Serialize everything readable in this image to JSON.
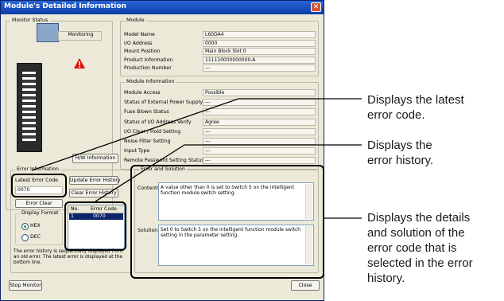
{
  "window": {
    "title": "Module's Detailed Information",
    "close_glyph": "✕"
  },
  "monitor_status": {
    "group_label": "Monitor Status",
    "state": "Monitoring"
  },
  "module": {
    "group_label": "Module",
    "rows": [
      {
        "label": "Model Name",
        "value": "L60DA4"
      },
      {
        "label": "I/O Address",
        "value": "0000"
      },
      {
        "label": "Mount Position",
        "value": "Main Block Slot 0"
      },
      {
        "label": "Product Information",
        "value": "111110000000000-A"
      },
      {
        "label": "Production Number",
        "value": "---"
      }
    ]
  },
  "module_information": {
    "group_label": "Module Information",
    "rows": [
      {
        "label": "Module Access",
        "value": "Possible"
      },
      {
        "label": "Status of External Power Supply",
        "value": "---"
      },
      {
        "label": "Fuse Blown Status",
        "value": "---"
      },
      {
        "label": "Status of I/O Address Verify",
        "value": "Agree"
      },
      {
        "label": "I/O Clear / Hold Setting",
        "value": "---"
      },
      {
        "label": "Noise Filter Setting",
        "value": "---"
      },
      {
        "label": "Input Type",
        "value": "---"
      },
      {
        "label": "Remote Password Setting Status",
        "value": "---"
      }
    ]
  },
  "hw_button": "H/W Information",
  "error_information": {
    "group_label": "Error Information",
    "latest_label": "Latest Error Code",
    "latest_value": "0070",
    "update_button": "Update Error History",
    "clear_history_button": "Clear Error History",
    "error_clear_button": "Error Clear",
    "display_format_label": "Display Format",
    "hex_label": "HEX",
    "dec_label": "DEC",
    "history_headers": [
      "No.",
      "Error Code"
    ],
    "history_rows": [
      {
        "no": "1",
        "code": "0070"
      }
    ],
    "note": "The error history is sequentially displayed from an old error. The latest error is displayed at the bottom line."
  },
  "error_solution": {
    "group_label": "Error and Solution",
    "contents_label": "Contents:",
    "contents_text": "A value other than 0 is set to Switch 5 on the intelligent function module switch setting.",
    "solution_label": "Solution:",
    "solution_text": "Set 0 to Switch 5 on the intelligent function module switch setting in the parameter setting."
  },
  "footer": {
    "stop_monitor": "Stop Monitor",
    "close": "Close"
  },
  "annotations": {
    "latest": [
      "Displays the latest",
      "error code."
    ],
    "history": [
      "Displays the",
      "error history."
    ],
    "details": [
      "Displays the details",
      "and solution of the",
      "error code that is",
      "selected in the error",
      "history."
    ]
  },
  "colors": {
    "window_bg": "#ece9d8",
    "title_bar": "#0b3ea8",
    "selection": "#0a246a",
    "warning": "#e01010"
  },
  "icons": [
    "plc-module-icon",
    "warning-triangle-icon",
    "close-icon",
    "radio-icon"
  ]
}
